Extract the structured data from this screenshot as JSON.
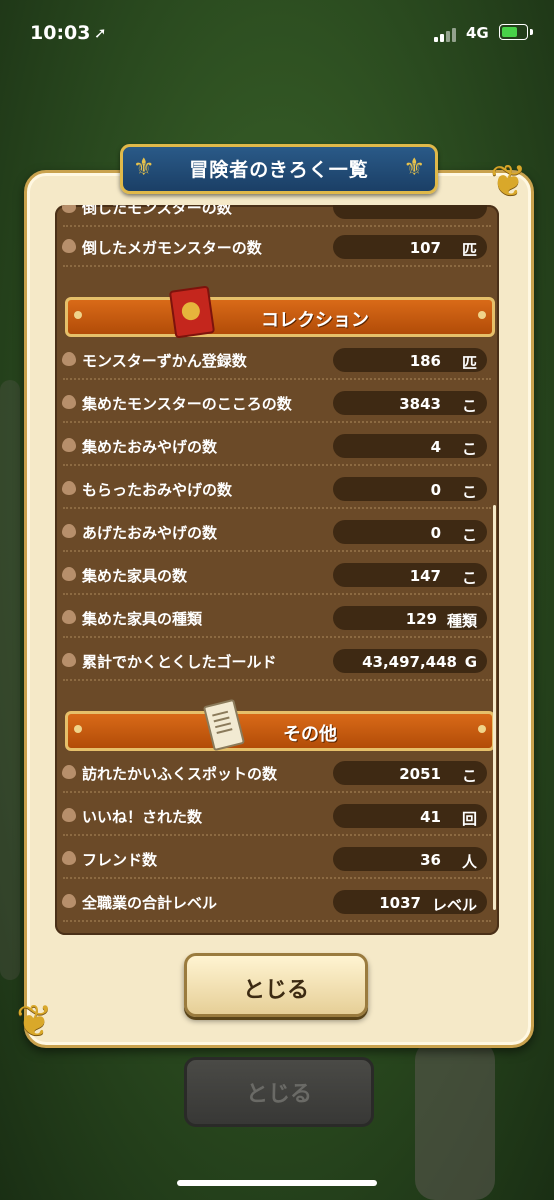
{
  "status_bar": {
    "time": "10:03",
    "network": "4G"
  },
  "window_title": "冒険者のきろく一覧",
  "rows_top": [
    {
      "label": "倒したモンスターの数",
      "value": "",
      "unit": ""
    },
    {
      "label": "倒したメガモンスターの数",
      "value": "107",
      "unit": "匹"
    }
  ],
  "section_collection": "コレクション",
  "rows_collection": [
    {
      "label": "モンスターずかん登録数",
      "value": "186",
      "unit": "匹"
    },
    {
      "label": "集めたモンスターのこころの数",
      "value": "3843",
      "unit": "こ"
    },
    {
      "label": "集めたおみやげの数",
      "value": "4",
      "unit": "こ"
    },
    {
      "label": "もらったおみやげの数",
      "value": "0",
      "unit": "こ"
    },
    {
      "label": "あげたおみやげの数",
      "value": "0",
      "unit": "こ"
    },
    {
      "label": "集めた家具の数",
      "value": "147",
      "unit": "こ"
    },
    {
      "label": "集めた家具の種類",
      "value": "129",
      "unit": "種類"
    },
    {
      "label": "累計でかくとくしたゴールド",
      "value": "43,497,448",
      "unit": "G"
    }
  ],
  "section_other": "その他",
  "rows_other": [
    {
      "label": "訪れたかいふくスポットの数",
      "value": "2051",
      "unit": "こ"
    },
    {
      "label": "いいね！された数",
      "value": "41",
      "unit": "回"
    },
    {
      "label": "フレンド数",
      "value": "36",
      "unit": "人"
    },
    {
      "label": "全職業の合計レベル",
      "value": "1037",
      "unit": "レベル"
    }
  ],
  "close_button": "とじる",
  "background_close_button": "とじる"
}
